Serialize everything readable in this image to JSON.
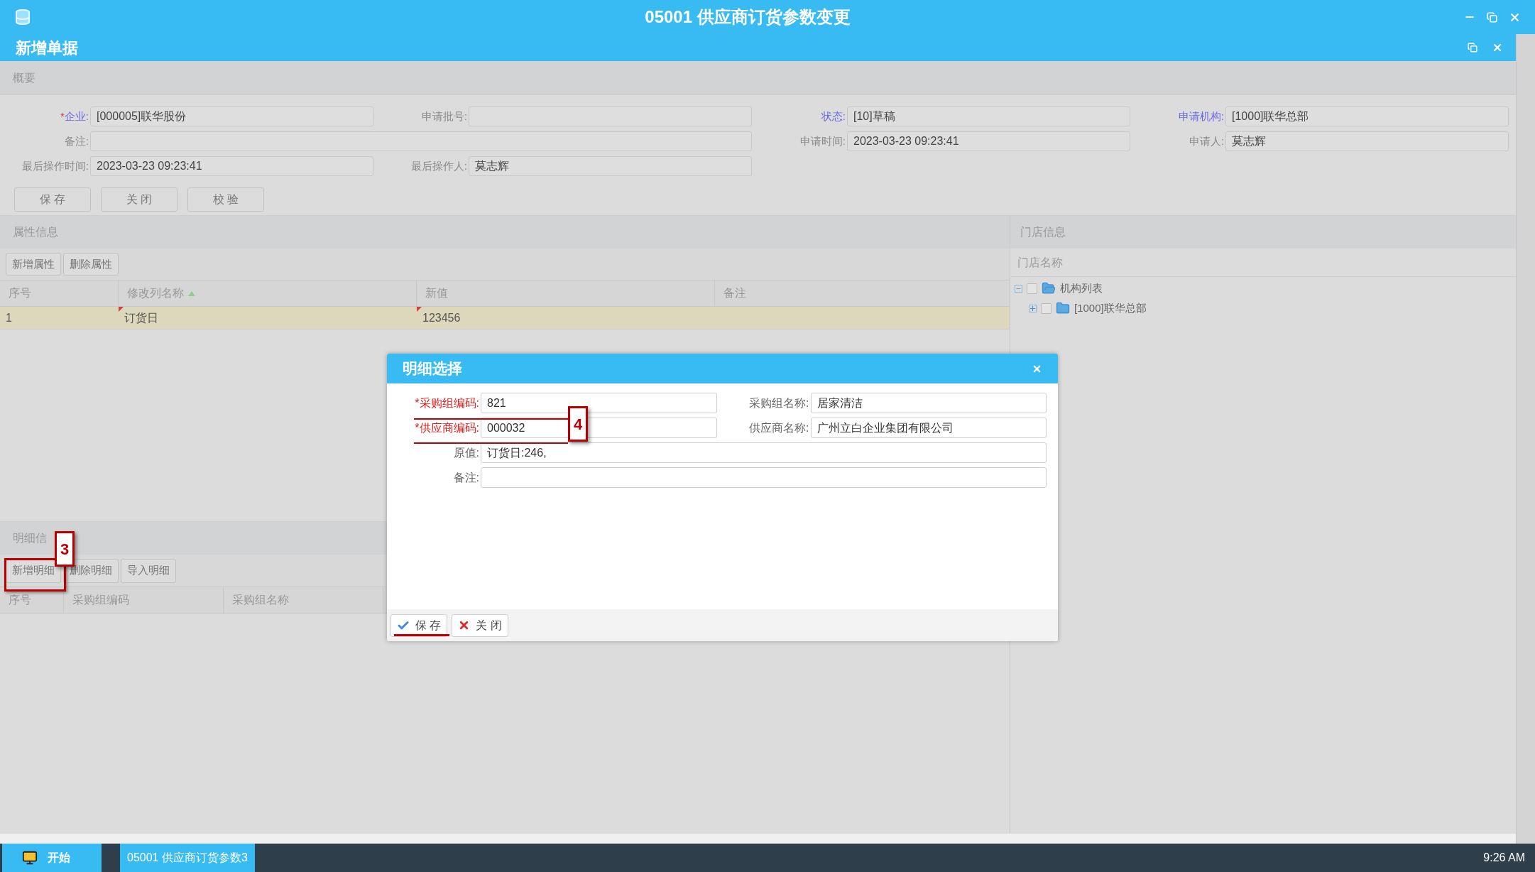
{
  "window": {
    "title": "05001 供应商订货参数变更"
  },
  "document": {
    "title": "新增单据"
  },
  "summary": {
    "title": "概要",
    "fields": [
      {
        "mark": "*",
        "label": "企业:",
        "value": "[000005]联华股份",
        "highlighted": true,
        "wide": false
      },
      {
        "label": "申请批号:",
        "highlighted": false,
        "wide": false
      },
      {
        "label": "状态:",
        "value": "[10]草稿",
        "highlighted": true,
        "wide": false
      },
      {
        "label": "申请机构:",
        "value": "[1000]联华总部",
        "highlighted": true,
        "wide": false
      },
      {
        "label": "备注:",
        "highlighted": false,
        "wide": true
      },
      {
        "label": "申请时间:",
        "value": "2023-03-23 09:23:41",
        "highlighted": false,
        "wide": false
      },
      {
        "label": "申请人:",
        "value": "莫志辉",
        "highlighted": false,
        "wide": false
      },
      {
        "label": "最后操作时间:",
        "value": "2023-03-23 09:23:41",
        "highlighted": false,
        "wide": false
      },
      {
        "label": "最后操作人:",
        "value": "莫志辉",
        "highlighted": false,
        "wide": false
      }
    ],
    "buttons": [
      "保 存",
      "关 闭",
      "校 验"
    ]
  },
  "properties": {
    "title": "属性信息",
    "buttons": [
      "新增属性",
      "删除属性"
    ],
    "columns": [
      {
        "label": "序号",
        "sorted": false
      },
      {
        "label": "修改列名称",
        "sorted": true
      },
      {
        "label": "新值",
        "sorted": false
      },
      {
        "label": "备注",
        "sorted": false
      }
    ],
    "rows": [
      {
        "selected": true,
        "cells": [
          {
            "text": "1",
            "modified": false
          },
          {
            "text": "订货日",
            "modified": true
          },
          {
            "text": "123456",
            "modified": true
          }
        ]
      }
    ]
  },
  "details": {
    "title": "明细信",
    "buttons": [
      "新增明细",
      "删除明细",
      "导入明细"
    ],
    "columns": [
      "序号",
      "采购组编码",
      "采购组名称"
    ]
  },
  "stores": {
    "title": "门店信息",
    "column": "门店名称",
    "tree": [
      {
        "label": "机构列表",
        "expanded": true,
        "checked": false,
        "children": [
          {
            "label": "[1000]联华总部",
            "expanded": false,
            "checked": false
          }
        ]
      }
    ]
  },
  "dialog": {
    "title": "明细选择",
    "fields": [
      {
        "mark": "*",
        "label": "采购组编码:",
        "value": "821",
        "required": true,
        "wide": false
      },
      {
        "label": "采购组名称:",
        "value": "居家清洁",
        "required": false,
        "wide": false
      },
      {
        "mark": "*",
        "label": "供应商编码:",
        "value": "000032",
        "required": true,
        "wide": false
      },
      {
        "label": "供应商名称:",
        "value": "广州立白企业集团有限公司",
        "required": false,
        "wide": false
      },
      {
        "label": "原值:",
        "value": "订货日:246,",
        "required": false,
        "wide": true
      },
      {
        "label": "备注:",
        "required": false,
        "wide": true
      }
    ],
    "buttons": [
      {
        "label": "保 存",
        "kind": "save"
      },
      {
        "label": "关 闭",
        "kind": "close"
      }
    ]
  },
  "annotations": [
    {
      "text": "3"
    },
    {
      "text": "4"
    }
  ],
  "taskbar": {
    "start": "开始",
    "tasks": [
      {
        "label": "05001 供应商订货参数3",
        "selected": true
      }
    ],
    "time": "9:26 AM"
  }
}
